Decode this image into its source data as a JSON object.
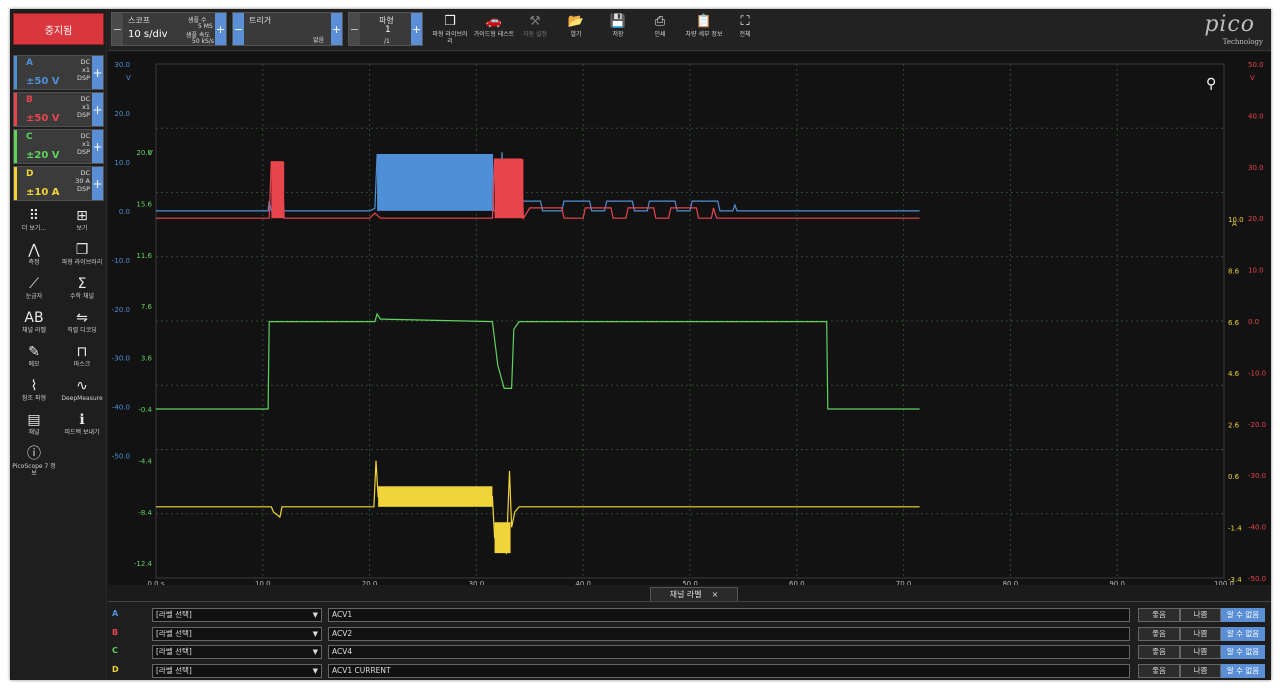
{
  "app": {
    "stop_button": "중지됨",
    "channels": [
      {
        "letter": "A",
        "range": "±50 V",
        "info": "DC\nx1\nDSP",
        "color": "#4f8fd8"
      },
      {
        "letter": "B",
        "range": "±50 V",
        "info": "DC\nx1\nDSP",
        "color": "#e8454c"
      },
      {
        "letter": "C",
        "range": "±20 V",
        "info": "DC\nx1\nDSP",
        "color": "#5ed35e"
      },
      {
        "letter": "D",
        "range": "±10 A",
        "info": "DC\n30 A\nDSP",
        "color": "#f0d43a"
      }
    ],
    "tools": [
      {
        "label": "더 보기...",
        "icon": "grid-dots-icon",
        "glyph": "⠿"
      },
      {
        "label": "보기",
        "icon": "view-icon",
        "glyph": "⊞"
      },
      {
        "label": "측정",
        "icon": "measure-icon",
        "glyph": "⋀"
      },
      {
        "label": "파형 라이브러리",
        "icon": "library-icon",
        "glyph": "❒"
      },
      {
        "label": "눈금자",
        "icon": "ruler-icon",
        "glyph": "⟋"
      },
      {
        "label": "수학 채널",
        "icon": "sigma-icon",
        "glyph": "Σ"
      },
      {
        "label": "채널 라벨",
        "icon": "channel-label-icon",
        "glyph": "AB"
      },
      {
        "label": "직렬 디코딩",
        "icon": "serial-decode-icon",
        "glyph": "⇋"
      },
      {
        "label": "메모",
        "icon": "memo-icon",
        "glyph": "✎"
      },
      {
        "label": "마스크",
        "icon": "mask-icon",
        "glyph": "⊓"
      },
      {
        "label": "참조 파형",
        "icon": "reference-icon",
        "glyph": "⌇"
      },
      {
        "label": "DeepMeasure",
        "icon": "deepmeasure-icon",
        "glyph": "∿"
      },
      {
        "label": "채널",
        "icon": "clapper-icon",
        "glyph": "▤"
      },
      {
        "label": "피드백 보내기",
        "icon": "feedback-icon",
        "glyph": "ℹ"
      },
      {
        "label": "PicoScope 7 정보",
        "icon": "about-icon",
        "glyph": "ⓘ"
      }
    ]
  },
  "toolbar": {
    "scope_label": "스코프",
    "timebase": "10 s/div",
    "samples_label": "샘플 수",
    "samples_value": "5 MS",
    "rate_label": "샘플 속도",
    "rate_value": "50 kS/s",
    "trigger_label": "트리거",
    "trigger_value": "없음",
    "waveform_label": "파형",
    "waveform_value": "1",
    "waveform_total": "/1",
    "buttons": [
      {
        "label": "파형 라이브러리",
        "icon": "library-icon",
        "glyph": "❒",
        "disabled": false
      },
      {
        "label": "가이드형 테스트",
        "icon": "car-icon",
        "glyph": "🚗",
        "disabled": false
      },
      {
        "label": "자동 설정",
        "icon": "wand-icon",
        "glyph": "⚒",
        "disabled": true
      },
      {
        "label": "열기",
        "icon": "folder-icon",
        "glyph": "📂",
        "disabled": false
      },
      {
        "label": "저장",
        "icon": "save-icon",
        "glyph": "💾",
        "disabled": false
      },
      {
        "label": "인쇄",
        "icon": "print-icon",
        "glyph": "⎙",
        "disabled": false
      },
      {
        "label": "차량 세부 정보",
        "icon": "clipboard-icon",
        "glyph": "📋",
        "disabled": false
      },
      {
        "label": "전체",
        "icon": "fullscreen-icon",
        "glyph": "⛶",
        "disabled": false
      }
    ],
    "logo_text": "pico",
    "logo_sub": "Technology"
  },
  "chart_data": {
    "type": "line",
    "x_ticks": [
      "0.0 s",
      "10.0",
      "20.0",
      "30.0",
      "40.0",
      "50.0",
      "60.0",
      "70.0",
      "80.0",
      "90.0",
      "100.0"
    ],
    "xlim": [
      0,
      100
    ],
    "axes": {
      "A": {
        "unit": "V",
        "ticks": [
          "30.0",
          "20.0",
          "10.0",
          "0.0",
          "-10.0",
          "-20.0",
          "-30.0",
          "-40.0",
          "-50.0"
        ]
      },
      "C": {
        "unit": "V",
        "ticks": [
          "20.0",
          "15.6",
          "11.6",
          "7.6",
          "3.6",
          "-0.4",
          "-4.4",
          "-8.4",
          "-12.4"
        ]
      },
      "B": {
        "unit": "V",
        "ticks": [
          "50.0",
          "40.0",
          "30.0",
          "20.0",
          "10.0",
          "0.0",
          "-10.0",
          "-20.0",
          "-30.0",
          "-40.0",
          "-50.0"
        ]
      },
      "D": {
        "unit": "A",
        "ticks": [
          "10.0",
          "8.6",
          "6.6",
          "4.6",
          "2.6",
          "0.6",
          "-1.4",
          "-3.4"
        ]
      }
    },
    "series": [
      {
        "name": "ACV1",
        "channel": "A",
        "color": "#4f8fd8",
        "points": [
          [
            0,
            0
          ],
          [
            10.5,
            0
          ],
          [
            10.6,
            2
          ],
          [
            10.8,
            0
          ],
          [
            20,
            0
          ],
          [
            20.5,
            0.5
          ],
          [
            20.7,
            11.5
          ],
          [
            31.5,
            11.5
          ],
          [
            31.6,
            0
          ],
          [
            32.3,
            0
          ],
          [
            32.4,
            12
          ],
          [
            32.6,
            0
          ],
          [
            33,
            2
          ],
          [
            36,
            2
          ],
          [
            36.2,
            0
          ],
          [
            38,
            0
          ],
          [
            38.2,
            2
          ],
          [
            40.6,
            2
          ],
          [
            40.8,
            0
          ],
          [
            42,
            0
          ],
          [
            42.2,
            2
          ],
          [
            44.6,
            2
          ],
          [
            44.8,
            0
          ],
          [
            46,
            0
          ],
          [
            46.2,
            2
          ],
          [
            48.6,
            2
          ],
          [
            48.8,
            0
          ],
          [
            50,
            0
          ],
          [
            50.2,
            2
          ],
          [
            52.6,
            2
          ],
          [
            52.8,
            0
          ],
          [
            54,
            0
          ],
          [
            54.2,
            1.2
          ],
          [
            54.4,
            0
          ],
          [
            71.5,
            0
          ]
        ],
        "filled": [
          [
            20.7,
            31.5,
            0,
            11.5
          ]
        ]
      },
      {
        "name": "ACV2",
        "channel": "B",
        "color": "#e8454c",
        "points": [
          [
            0,
            20
          ],
          [
            10.6,
            20
          ],
          [
            10.8,
            31
          ],
          [
            11.8,
            31
          ],
          [
            12,
            20
          ],
          [
            20,
            20
          ],
          [
            20.5,
            21
          ],
          [
            21,
            20
          ],
          [
            31.5,
            20
          ],
          [
            31.7,
            31.5
          ],
          [
            34.2,
            31.5
          ],
          [
            34.4,
            20
          ],
          [
            35,
            22
          ],
          [
            38,
            22
          ],
          [
            38.2,
            20
          ],
          [
            40,
            20
          ],
          [
            40.2,
            22
          ],
          [
            42.6,
            22
          ],
          [
            42.8,
            20
          ],
          [
            44,
            20
          ],
          [
            44.2,
            22
          ],
          [
            46.6,
            22
          ],
          [
            46.8,
            20
          ],
          [
            48,
            20
          ],
          [
            48.2,
            22
          ],
          [
            50.6,
            22
          ],
          [
            50.8,
            20
          ],
          [
            52,
            20
          ],
          [
            52.2,
            22
          ],
          [
            52.5,
            20
          ],
          [
            71.5,
            20
          ]
        ],
        "filled": [
          [
            10.8,
            12,
            20,
            31
          ],
          [
            31.7,
            34.4,
            20,
            31.5
          ]
        ]
      },
      {
        "name": "ACV4",
        "channel": "C",
        "color": "#5ed35e",
        "points": [
          [
            0,
            -0.4
          ],
          [
            10.5,
            -0.4
          ],
          [
            10.6,
            6.4
          ],
          [
            20.5,
            6.4
          ],
          [
            20.7,
            7.0
          ],
          [
            21,
            6.6
          ],
          [
            31.5,
            6.4
          ],
          [
            32,
            3
          ],
          [
            32.6,
            1.2
          ],
          [
            33.3,
            1.2
          ],
          [
            33.5,
            5.8
          ],
          [
            34,
            6.4
          ],
          [
            62.8,
            6.4
          ],
          [
            62.9,
            -0.4
          ],
          [
            71.5,
            -0.4
          ]
        ],
        "filled": []
      },
      {
        "name": "ACV1 CURRENT",
        "channel": "D",
        "color": "#f0d43a",
        "points": [
          [
            0,
            -0.6
          ],
          [
            10.8,
            -0.6
          ],
          [
            11,
            -0.8
          ],
          [
            11.6,
            -1.0
          ],
          [
            11.8,
            -0.6
          ],
          [
            20.4,
            -0.6
          ],
          [
            20.6,
            1.2
          ],
          [
            20.8,
            -0.2
          ],
          [
            31.5,
            -0.2
          ],
          [
            31.7,
            -1.8
          ],
          [
            32.8,
            -2.4
          ],
          [
            33.1,
            0.8
          ],
          [
            33.3,
            -1.4
          ],
          [
            33.6,
            -0.8
          ],
          [
            34,
            -0.6
          ],
          [
            71.5,
            -0.6
          ]
        ],
        "filled": [
          [
            20.8,
            31.5,
            -0.6,
            0.2
          ],
          [
            31.7,
            33.2,
            -2.4,
            -1.2
          ]
        ]
      }
    ]
  },
  "labels_panel": {
    "tab_label": "채널 라벨",
    "close": "×",
    "rows": [
      {
        "letter": "A",
        "select": "[라벨 선택]",
        "name": "ACV1",
        "good": "좋음",
        "bad": "나쁨",
        "unknown": "알 수 없음"
      },
      {
        "letter": "B",
        "select": "[라벨 선택]",
        "name": "ACV2",
        "good": "좋음",
        "bad": "나쁨",
        "unknown": "알 수 없음"
      },
      {
        "letter": "C",
        "select": "[라벨 선택]",
        "name": "ACV4",
        "good": "좋음",
        "bad": "나쁨",
        "unknown": "알 수 없음"
      },
      {
        "letter": "D",
        "select": "[라벨 선택]",
        "name": "ACV1 CURRENT",
        "good": "좋음",
        "bad": "나쁨",
        "unknown": "알 수 없음"
      }
    ]
  }
}
